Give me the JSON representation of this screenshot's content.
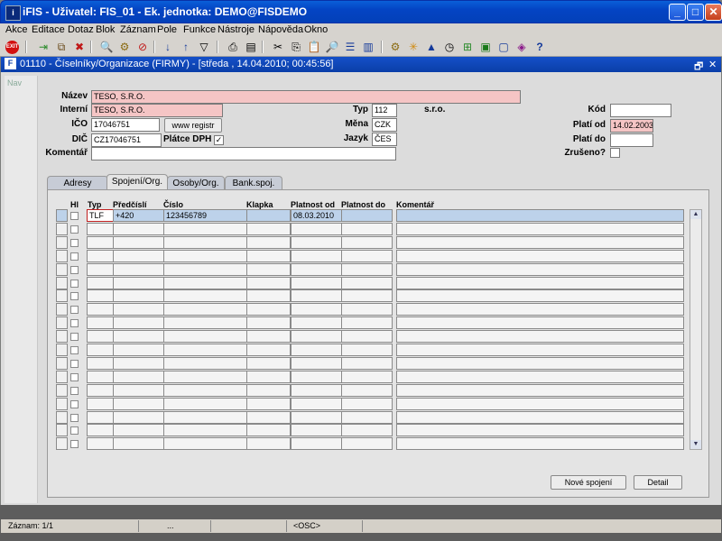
{
  "window": {
    "title": "iFIS - Uživatel: FIS_01 - Ek. jednotka: DEMO@FISDEMO",
    "app_icon": "iFIS-app-icon",
    "btn_min": "_",
    "btn_max": "□",
    "btn_close": "✕"
  },
  "menu": [
    "Akce",
    "Editace",
    "Dotaz",
    "Blok",
    "Záznam",
    "Pole",
    "Funkce",
    "Nástroje",
    "Nápověda",
    "Okno"
  ],
  "toolbar": {
    "exit_label": "EXIT"
  },
  "form_window": {
    "icon_label": "F",
    "title": "01110 - Číselníky/Organizace (FIRMY) - [středa , 14.04.2010; 00:45:56]",
    "restore": "🗗",
    "close": "✕"
  },
  "nav": {
    "label": "Nav"
  },
  "form": {
    "nazev_label": "Název",
    "nazev": "TESO, S.R.O.",
    "interni_label": "Interní",
    "interni": "TESO, S.R.O.",
    "ico_label": "IČO",
    "ico": "17046751",
    "www_label": "www registr",
    "dic_label": "DIČ",
    "dic": "CZ17046751",
    "platce_label": "Plátce DPH",
    "platce_mark": "✓",
    "komentar_label": "Komentář",
    "komentar": "",
    "typ_label": "Typ",
    "typ": "112",
    "typ_text": "s.r.o.",
    "mena_label": "Měna",
    "mena": "CZK",
    "jazyk_label": "Jazyk",
    "jazyk": "ČES",
    "kod_label": "Kód",
    "kod": "",
    "plati_od_label": "Platí od",
    "plati_od": "14.02.2003",
    "plati_do_label": "Platí do",
    "plati_do": "",
    "zruseno_label": "Zrušeno?"
  },
  "tabs": [
    "Adresy",
    "Spojení/Org.",
    "Osoby/Org.",
    "Bank.spoj."
  ],
  "table": {
    "headers": [
      "Hl",
      "Typ",
      "Předčíslí",
      "Číslo",
      "Klapka",
      "Platnost od",
      "Platnost do",
      "Komentář"
    ],
    "row1": [
      "TLF",
      "+420",
      "123456789",
      "",
      "08.03.2010",
      "",
      ""
    ]
  },
  "buttons": {
    "nove": "Nové spojení",
    "detail": "Detail"
  },
  "status": {
    "zaznam": "Záznam: 1/1",
    "dots": "...",
    "osc": "<OSC>"
  }
}
